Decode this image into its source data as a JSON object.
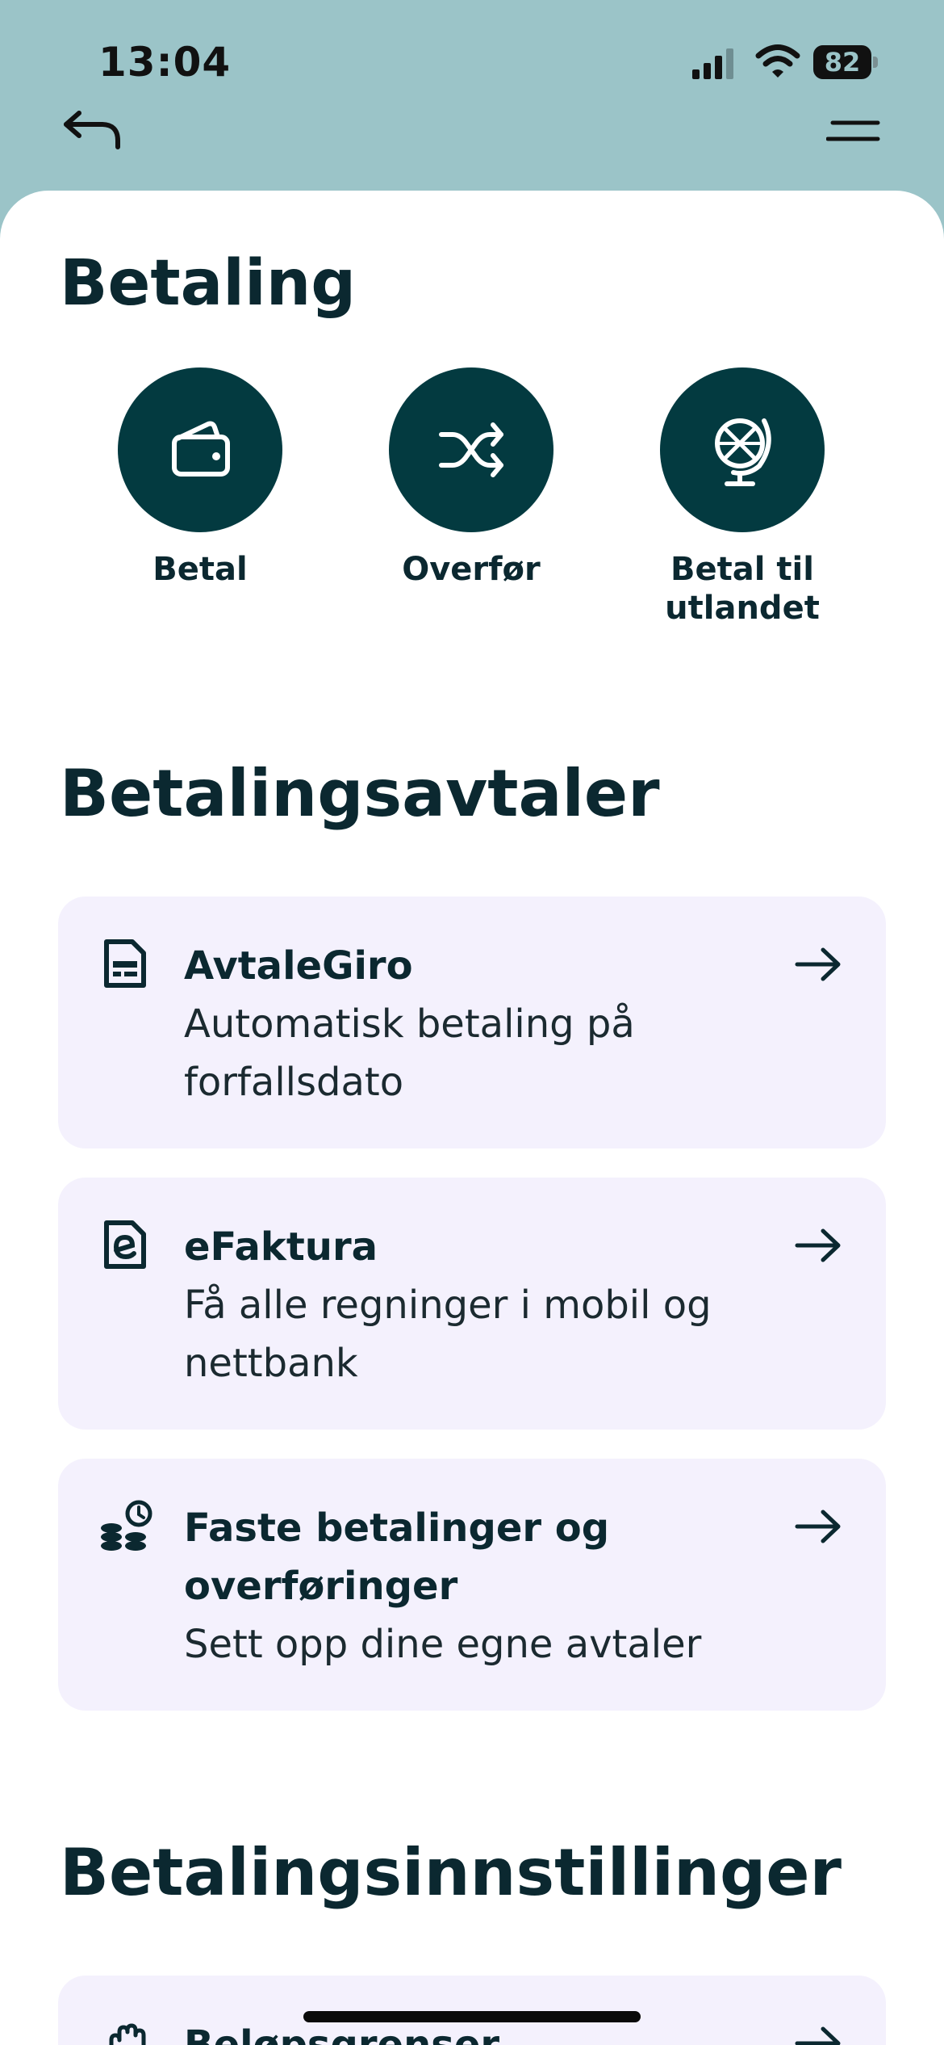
{
  "status_bar": {
    "time": "13:04",
    "battery_level": "82",
    "icons": [
      "cellular-signal-icon",
      "wifi-icon",
      "battery-icon"
    ]
  },
  "nav": {
    "back_icon": "back-arrow-icon",
    "menu_icon": "menu-icon"
  },
  "page": {
    "title": "Betaling"
  },
  "quick_actions": [
    {
      "label": "Betal",
      "icon": "wallet-icon"
    },
    {
      "label": "Overfør",
      "icon": "shuffle-icon"
    },
    {
      "label": "Betal til utlandet",
      "icon": "globe-icon"
    }
  ],
  "agreements": {
    "heading": "Betalingsavtaler",
    "items": [
      {
        "title": "AvtaleGiro",
        "description": "Automatisk betaling på forfallsdato",
        "icon": "invoice-document-icon"
      },
      {
        "title": "eFaktura",
        "description": "Få alle regninger i mobil og nettbank",
        "icon": "efaktura-document-icon"
      },
      {
        "title": "Faste betalinger og overføringer",
        "description": "Sett opp dine egne avtaler",
        "icon": "coins-clock-icon"
      }
    ]
  },
  "settings": {
    "heading": "Betalingsinnstillinger",
    "items": [
      {
        "title": "Beløpsgrenser",
        "icon": "hand-icon"
      }
    ]
  },
  "colors": {
    "header_bg": "#9bc4c8",
    "accent": "#033a40",
    "card_bg": "#f4f1fd",
    "text": "#0b2830"
  }
}
